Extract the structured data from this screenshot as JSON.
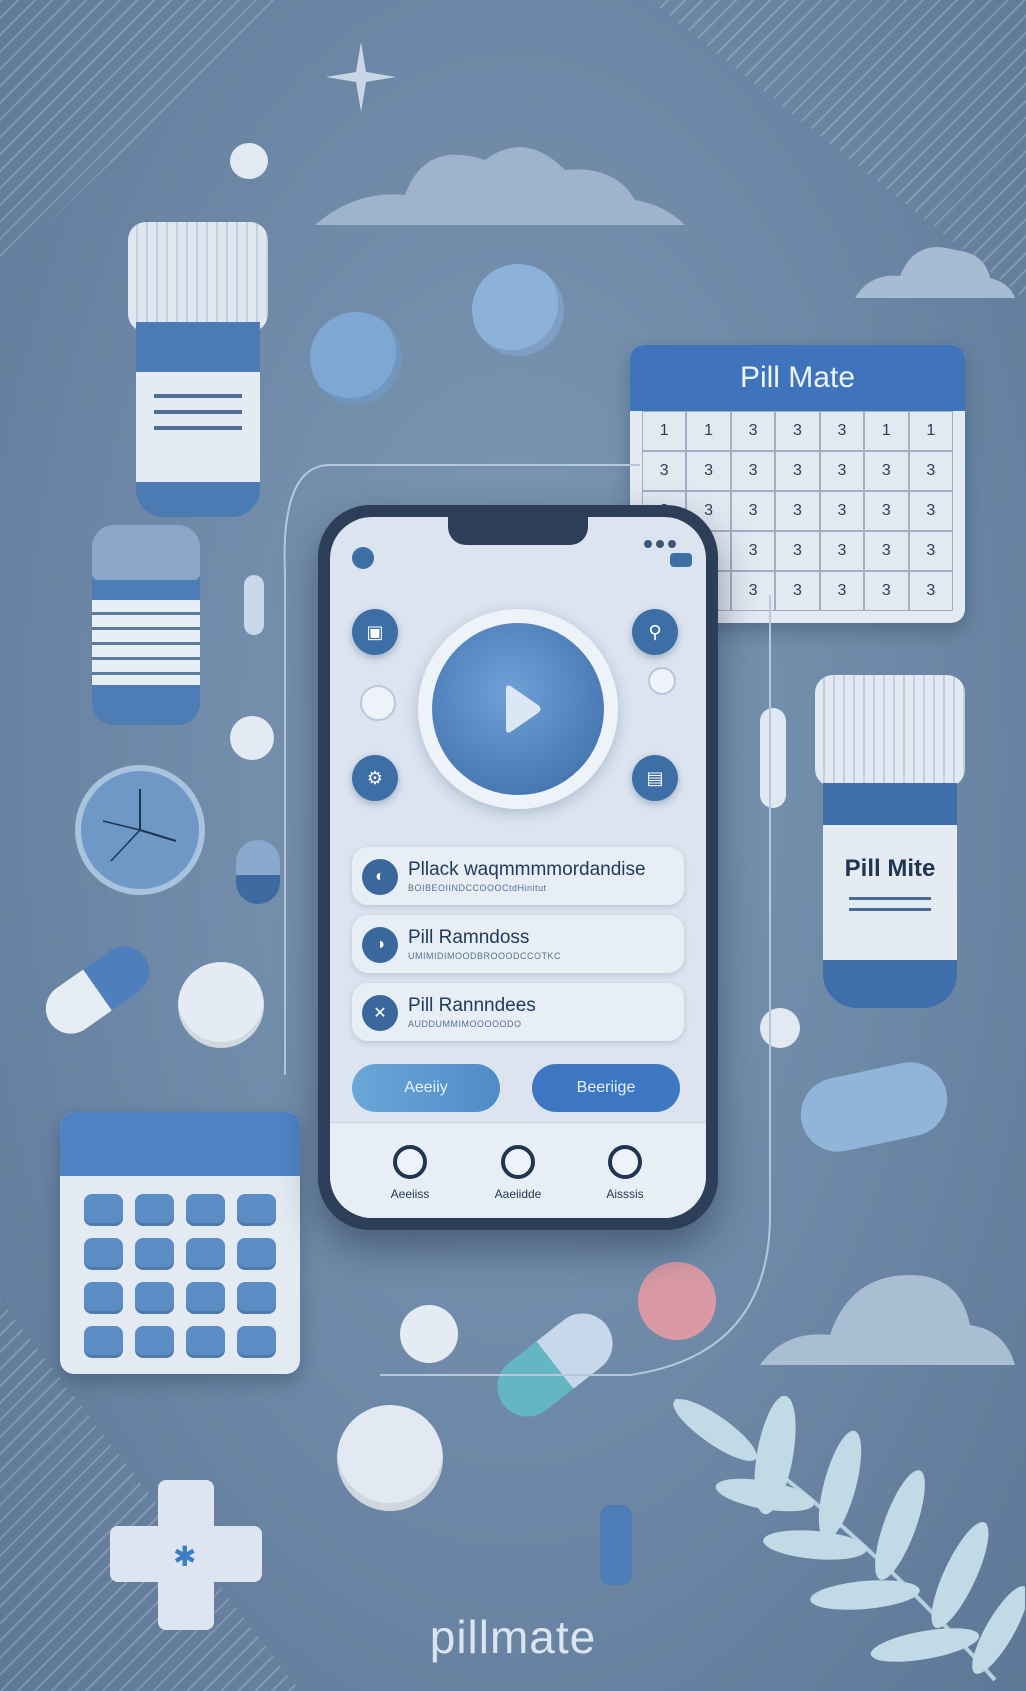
{
  "calendar": {
    "title": "Pill Mate",
    "days": [
      "1",
      "1",
      "3",
      "3",
      "3",
      "1",
      "1",
      "3",
      "3",
      "3",
      "3",
      "3",
      "3",
      "3",
      "3",
      "3",
      "3",
      "3",
      "3",
      "3",
      "3",
      "3",
      "3",
      "3",
      "3",
      "3",
      "3",
      "3",
      "3",
      "3",
      "3",
      "3",
      "3",
      "3",
      "3"
    ]
  },
  "bottle": {
    "label": "Pill Mite"
  },
  "phone": {
    "rows": [
      {
        "title": "Pllack waqmmmmordandise",
        "subtitle": "BOIBEOIINDCCOOOCtdHinitut"
      },
      {
        "title": "Pill Ramndoss",
        "subtitle": "UMIMIDIMOODBROOODCCOTKC"
      },
      {
        "title": "Pill Rannndees",
        "subtitle": "AUDDUMMIMOOOOODO"
      }
    ],
    "buttons": {
      "left": "Aeeiiy",
      "right": "Beeriige"
    },
    "nav": [
      {
        "label": "Aeeiiss"
      },
      {
        "label": "Aaeiidde"
      },
      {
        "label": "Aisssis"
      }
    ]
  },
  "footer": {
    "brand": "pillmate"
  },
  "colors": {
    "background": "#6d88a6",
    "accent": "#3e6ea6",
    "phone_frame": "#2d3f58",
    "screen": "#dbe4ef"
  }
}
